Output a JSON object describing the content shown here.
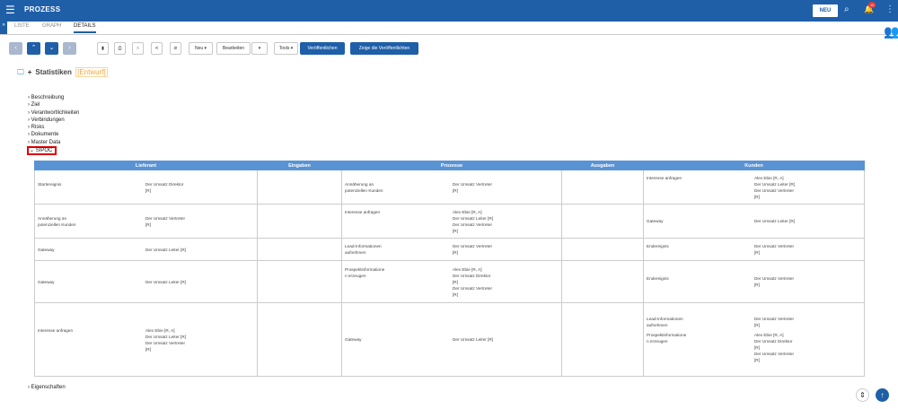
{
  "app": {
    "title": "PROZESS",
    "new_label": "NEU",
    "badge": "10"
  },
  "tabs": [
    "LISTE",
    "GRAPH",
    "DETAILS"
  ],
  "toolbar": {
    "neu": "Neu ▾",
    "bearbeiten": "Bearbeiten",
    "tools": "Tools ▾",
    "publish": "Veröffentlichen",
    "show_published": "Zeige die Veröffentlichten"
  },
  "heading": {
    "name": "Statistiken",
    "status": "[Entwurf]"
  },
  "sections": [
    "Beschreibung",
    "Ziel",
    "Verantwortlichkeiten",
    "Verbindungen",
    "Risks",
    "Dokumente",
    "Master Data"
  ],
  "sipoc_label": "SIPOC",
  "table": {
    "headers": [
      "Lieferant",
      "Eingaben",
      "Prozesse",
      "Ausgaben",
      "Kunden"
    ],
    "rows": [
      {
        "s_label": "Startereignis",
        "s_who": "Der Umsatz Direktor\n[R]",
        "p_label": "Annäherung an\npotenziellen Kunden",
        "p_who": "Der Umsatz Vertreter\n[R]",
        "c": [
          {
            "label": "Interesse anfragen",
            "who": "Alex Ebie [R, A]\nDer Umsatz Leiter [R]\nDer Umsatz Vertreter\n[R]"
          }
        ]
      },
      {
        "s_label": "Annäherung an\npotenziellen Kunden",
        "s_who": "Der Umsatz Vertreter\n[R]",
        "p_label": "Interesse anfragen",
        "p_who": "Alex Ebie [R, A]\nDer Umsatz Leiter [R]\nDer Umsatz Vertreter\n[R]",
        "c": [
          {
            "label": "Gateway",
            "who": "Der Umsatz Leiter [R]"
          }
        ]
      },
      {
        "s_label": "Gateway",
        "s_who": "Der Umsatz Leiter [R]",
        "p_label": "Lead-Informationen\naufnehmen",
        "p_who": "Der Umsatz Vertreter\n[R]",
        "c": [
          {
            "label": "Endereignis",
            "who": "Der Umsatz Vertreter\n[R]"
          }
        ]
      },
      {
        "s_label": "Gateway",
        "s_who": "Der Umsatz Leiter [R]",
        "p_label": "Prospektinformatione\nn erzeugen",
        "p_who": "Alex Ebie [R, A]\nDer Umsatz Direktor\n[R]\nDer Umsatz Vertreter\n[R]",
        "c": [
          {
            "label": "Endereignis",
            "who": "Der Umsatz Vertreter\n[R]"
          }
        ]
      },
      {
        "s_label": "Interesse anfragen",
        "s_who": "Alex Ebie [R, A]\nDer Umsatz Leiter [R]\nDer Umsatz Vertreter\n[R]",
        "p_label": "Gateway",
        "p_who": "Der Umsatz Leiter [R]",
        "c": [
          {
            "label": "Lead-Informationen\naufnehmen",
            "who": "Der Umsatz Vertreter\n[R]"
          },
          {
            "label": "Prospektinformatione\nn erzeugen",
            "who": "Alex Ebie [R, A]\nDer Umsatz Direktor\n[R]\nDer Umsatz Vertreter\n[R]"
          }
        ]
      }
    ]
  },
  "eigenschaften": "Eigenschaften"
}
